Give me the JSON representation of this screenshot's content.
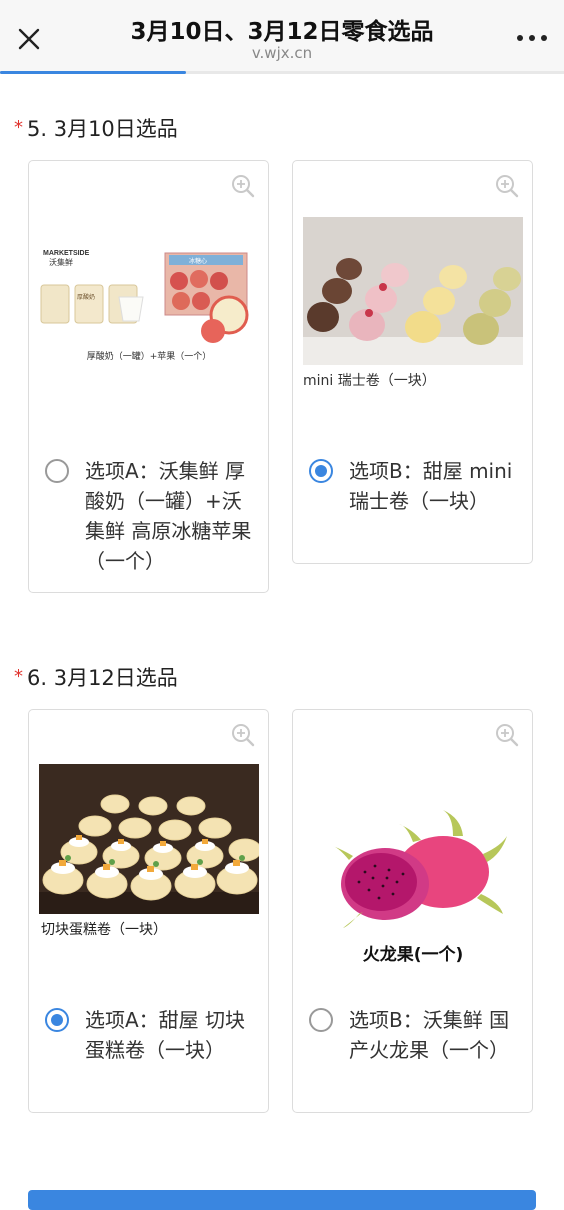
{
  "header": {
    "title": "3月10日、3月12日零食选品",
    "subtitle": "v.wjx.cn",
    "progress": 0.33,
    "accent": "#3a86e0"
  },
  "questions": [
    {
      "number": "5. 3月10日选品",
      "required_mark": "*",
      "options": [
        {
          "label": "选项A：沃集鲜 厚酸奶（一罐）+沃集鲜 高原冰糖苹果（一个）",
          "selected": false,
          "image": {
            "brand_text": "MARKETSIDE",
            "brand_cn": "沃集鲜",
            "cup_label": "厚酸奶",
            "box_label": "冰糖心",
            "caption": "厚酸奶（一罐）+苹果（一个）"
          }
        },
        {
          "label": "选项B：甜屋 mini瑞士卷（一块）",
          "selected": true,
          "image": {
            "caption": "mini 瑞士卷（一块）"
          }
        }
      ]
    },
    {
      "number": "6. 3月12日选品",
      "required_mark": "*",
      "options": [
        {
          "label": "选项A：甜屋 切块蛋糕卷（一块）",
          "selected": true,
          "image": {
            "caption": "切块蛋糕卷（一块）"
          }
        },
        {
          "label": "选项B：沃集鲜 国产火龙果（一个）",
          "selected": false,
          "image": {
            "caption": "火龙果(一个)"
          }
        }
      ]
    }
  ]
}
